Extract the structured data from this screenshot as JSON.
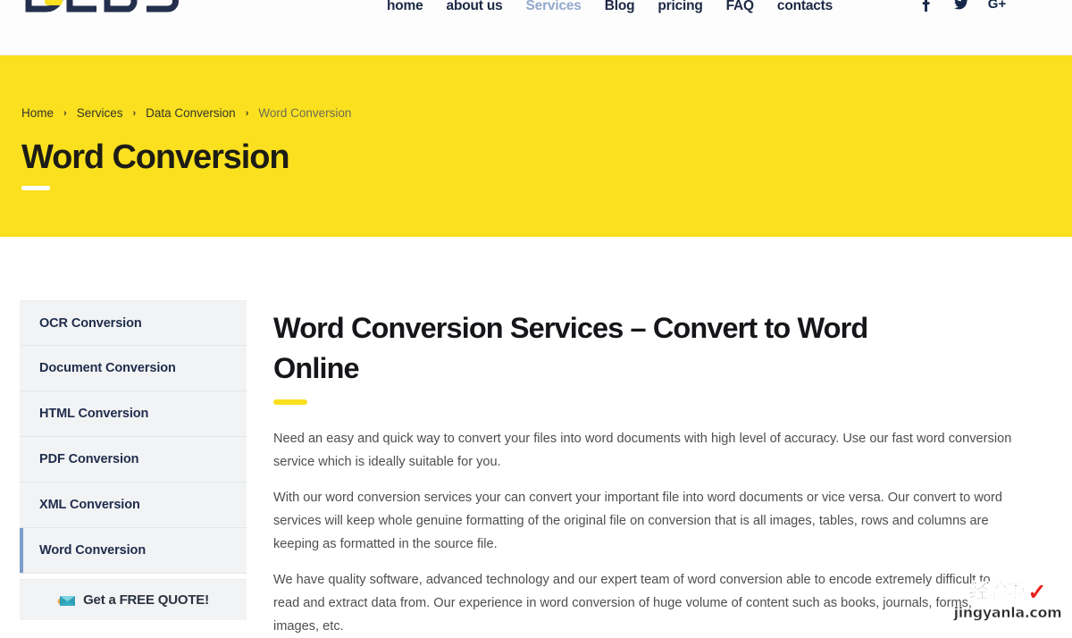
{
  "header": {
    "logo_text": "DEBS",
    "nav": [
      {
        "label": "home",
        "active": false
      },
      {
        "label": "about us",
        "active": false
      },
      {
        "label": "Services",
        "active": true
      },
      {
        "label": "Blog",
        "active": false
      },
      {
        "label": "pricing",
        "active": false
      },
      {
        "label": "FAQ",
        "active": false
      },
      {
        "label": "contacts",
        "active": false
      }
    ],
    "socials": [
      {
        "name": "facebook-icon",
        "glyph": "f"
      },
      {
        "name": "twitter-icon",
        "glyph": "✈"
      },
      {
        "name": "google-plus-icon",
        "glyph": "G+"
      }
    ]
  },
  "banner": {
    "background_color": "#fae01e",
    "breadcrumb": [
      "Home",
      "Services",
      "Data Conversion",
      "Word Conversion"
    ],
    "separator": "›",
    "title": "Word Conversion"
  },
  "sidebar": {
    "items": [
      {
        "label": "OCR Conversion",
        "active": false
      },
      {
        "label": "Document Conversion",
        "active": false
      },
      {
        "label": "HTML Conversion",
        "active": false
      },
      {
        "label": "PDF Conversion",
        "active": false
      },
      {
        "label": "XML Conversion",
        "active": false
      },
      {
        "label": "Word Conversion",
        "active": true
      }
    ],
    "active_border_color": "#7b9dc9",
    "quote_button": {
      "label": "Get a FREE QUOTE!",
      "icon": "envelope-icon"
    }
  },
  "content": {
    "title": "Word Conversion Services – Convert to Word Online",
    "accent_color": "#fae01e",
    "paragraphs": [
      "Need an easy and quick way to convert your files into word documents with high level of accuracy. Use our fast word conversion service which is ideally suitable for you.",
      "With our word conversion services your can convert your important file into word documents or vice versa. Our convert to word services will keep whole genuine formatting of the original file on conversion that is all images, tables, rows and columns are keeping as formatted in the source file.",
      "We have quality software, advanced technology and our expert team of word conversion able to encode extremely difficult to read and extract data from. Our experience in word conversion of huge volume of content such as books, journals, forms, images, etc."
    ]
  },
  "watermark": {
    "chinese": "经验啦",
    "check": "✓",
    "url": "jingyanla.com"
  }
}
